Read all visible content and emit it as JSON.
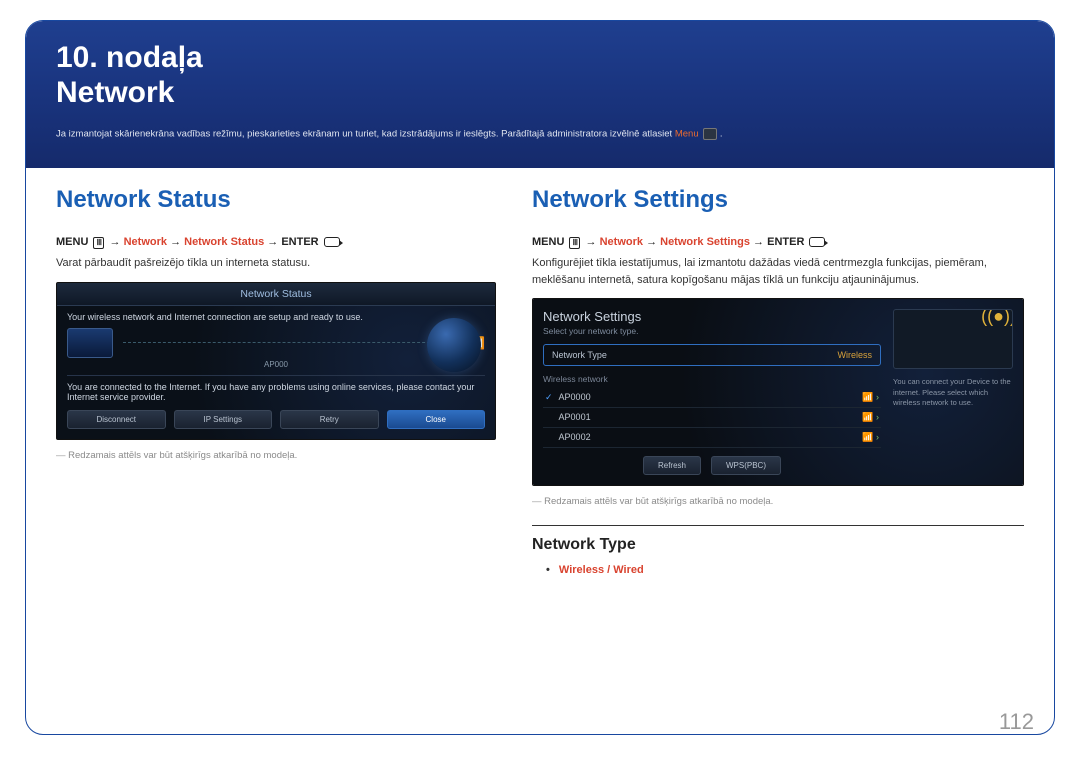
{
  "banner": {
    "chapter": "10. nodaļa",
    "title": "Network",
    "note_prefix": "Ja izmantojat skārienekrāna vadības režīmu, pieskarieties ekrānam un turiet, kad izstrādājums ir ieslēgts. Parādītajā administratora izvēlnē atlasiet ",
    "note_menu": "Menu",
    "note_suffix": "."
  },
  "status": {
    "heading": "Network Status",
    "path": {
      "menu": "MENU",
      "seg1": "Network",
      "seg2": "Network Status",
      "enter": "ENTER"
    },
    "desc": "Varat pārbaudīt pašreizējo tīkla un interneta statusu.",
    "screenshot": {
      "title": "Network Status",
      "line1": "Your wireless network and Internet connection are setup and ready to use.",
      "ap": "AP000",
      "line2": "You are connected to the Internet. If you have any problems using online services, please contact your Internet service provider.",
      "buttons": [
        "Disconnect",
        "IP Settings",
        "Retry",
        "Close"
      ]
    },
    "footnote": "Redzamais attēls var būt atšķirīgs atkarībā no modeļa."
  },
  "settings": {
    "heading": "Network Settings",
    "path": {
      "menu": "MENU",
      "seg1": "Network",
      "seg2": "Network Settings",
      "enter": "ENTER"
    },
    "desc": "Konfigurējiet tīkla iestatījumus, lai izmantotu dažādas viedā centrmezgla funkcijas, piemēram, meklēšanu internetā, satura kopīgošanu mājas tīklā un funkciju atjauninājumus.",
    "screenshot": {
      "title": "Network Settings",
      "subtitle": "Select your network type.",
      "type_label": "Network Type",
      "type_value": "Wireless",
      "list_label": "Wireless network",
      "items": [
        "AP0000",
        "AP0001",
        "AP0002"
      ],
      "buttons": [
        "Refresh",
        "WPS(PBC)"
      ],
      "info": "You can connect your Device to the internet. Please select which wireless network to use."
    },
    "footnote": "Redzamais attēls var būt atšķirīgs atkarībā no modeļa."
  },
  "network_type": {
    "heading": "Network Type",
    "option1": "Wireless",
    "sep": " / ",
    "option2": "Wired"
  },
  "page_number": "112"
}
